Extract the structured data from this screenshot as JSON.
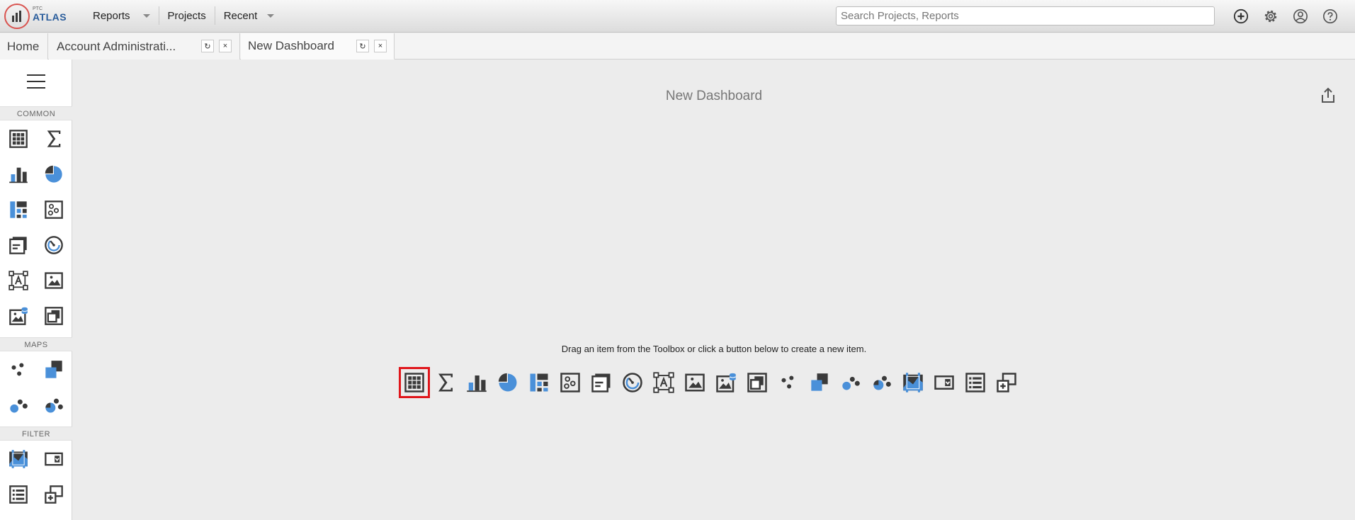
{
  "app": {
    "logo_small": "PTC",
    "logo_name": "ATLAS"
  },
  "menu": {
    "reports": "Reports",
    "projects": "Projects",
    "recent": "Recent"
  },
  "search": {
    "placeholder": "Search Projects, Reports"
  },
  "top_icons": [
    "add-icon",
    "gear-icon",
    "user-icon",
    "help-icon"
  ],
  "tabs": [
    {
      "label": "Home"
    },
    {
      "label": "Account Administrati..."
    },
    {
      "label": "New Dashboard"
    }
  ],
  "tab_controls": {
    "refresh": "↻",
    "close": "×"
  },
  "sidebar": {
    "sections": {
      "common": "COMMON",
      "maps": "MAPS",
      "filter": "FILTER"
    }
  },
  "dashboard": {
    "title": "New Dashboard",
    "hint": "Drag an item from the Toolbox or click a button below to create a new item."
  },
  "colors": {
    "accent_blue": "#4a90d9",
    "icon_dark": "#3a3a3a",
    "selection_red": "#e0161b",
    "logo_red": "#d9534f",
    "logo_blue": "#2a5d9c"
  }
}
